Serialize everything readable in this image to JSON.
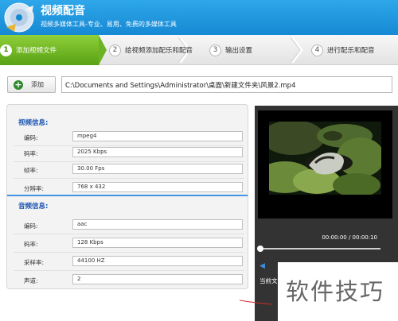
{
  "app": {
    "title": "视频配音",
    "subtitle": "视频多媒体工具-专业、易用、免费的多媒体工具",
    "brand_blue": "#1689d4",
    "accent_green": "#6db324"
  },
  "steps": [
    {
      "num": "1",
      "label": "添加视频文件",
      "active": true
    },
    {
      "num": "2",
      "label": "给视频添加配乐和配音",
      "active": false
    },
    {
      "num": "3",
      "label": "输出设置",
      "active": false
    },
    {
      "num": "4",
      "label": "进行配乐和配音",
      "active": false
    }
  ],
  "toolbar": {
    "add_label": "添加",
    "file_path": "C:\\Documents and Settings\\Administrator\\桌面\\新建文件夹\\风景2.mp4"
  },
  "video_info": {
    "title": "视频信息:",
    "rows": [
      {
        "label": "编码:",
        "value": "mpeg4"
      },
      {
        "label": "码率:",
        "value": "2025 Kbps"
      },
      {
        "label": "帧率:",
        "value": "30.00 Fps"
      },
      {
        "label": "分辨率:",
        "value": "768 x 432"
      }
    ]
  },
  "audio_info": {
    "title": "音频信息:",
    "rows": [
      {
        "label": "编码:",
        "value": "aac"
      },
      {
        "label": "码率:",
        "value": "128 Kbps"
      },
      {
        "label": "采样率:",
        "value": "44100 HZ"
      },
      {
        "label": "声道:",
        "value": "2"
      }
    ]
  },
  "player": {
    "time": "00:00:00 / 00:00:10",
    "current_label": "当前文",
    "progress": 0
  },
  "watermark": "软件技巧"
}
